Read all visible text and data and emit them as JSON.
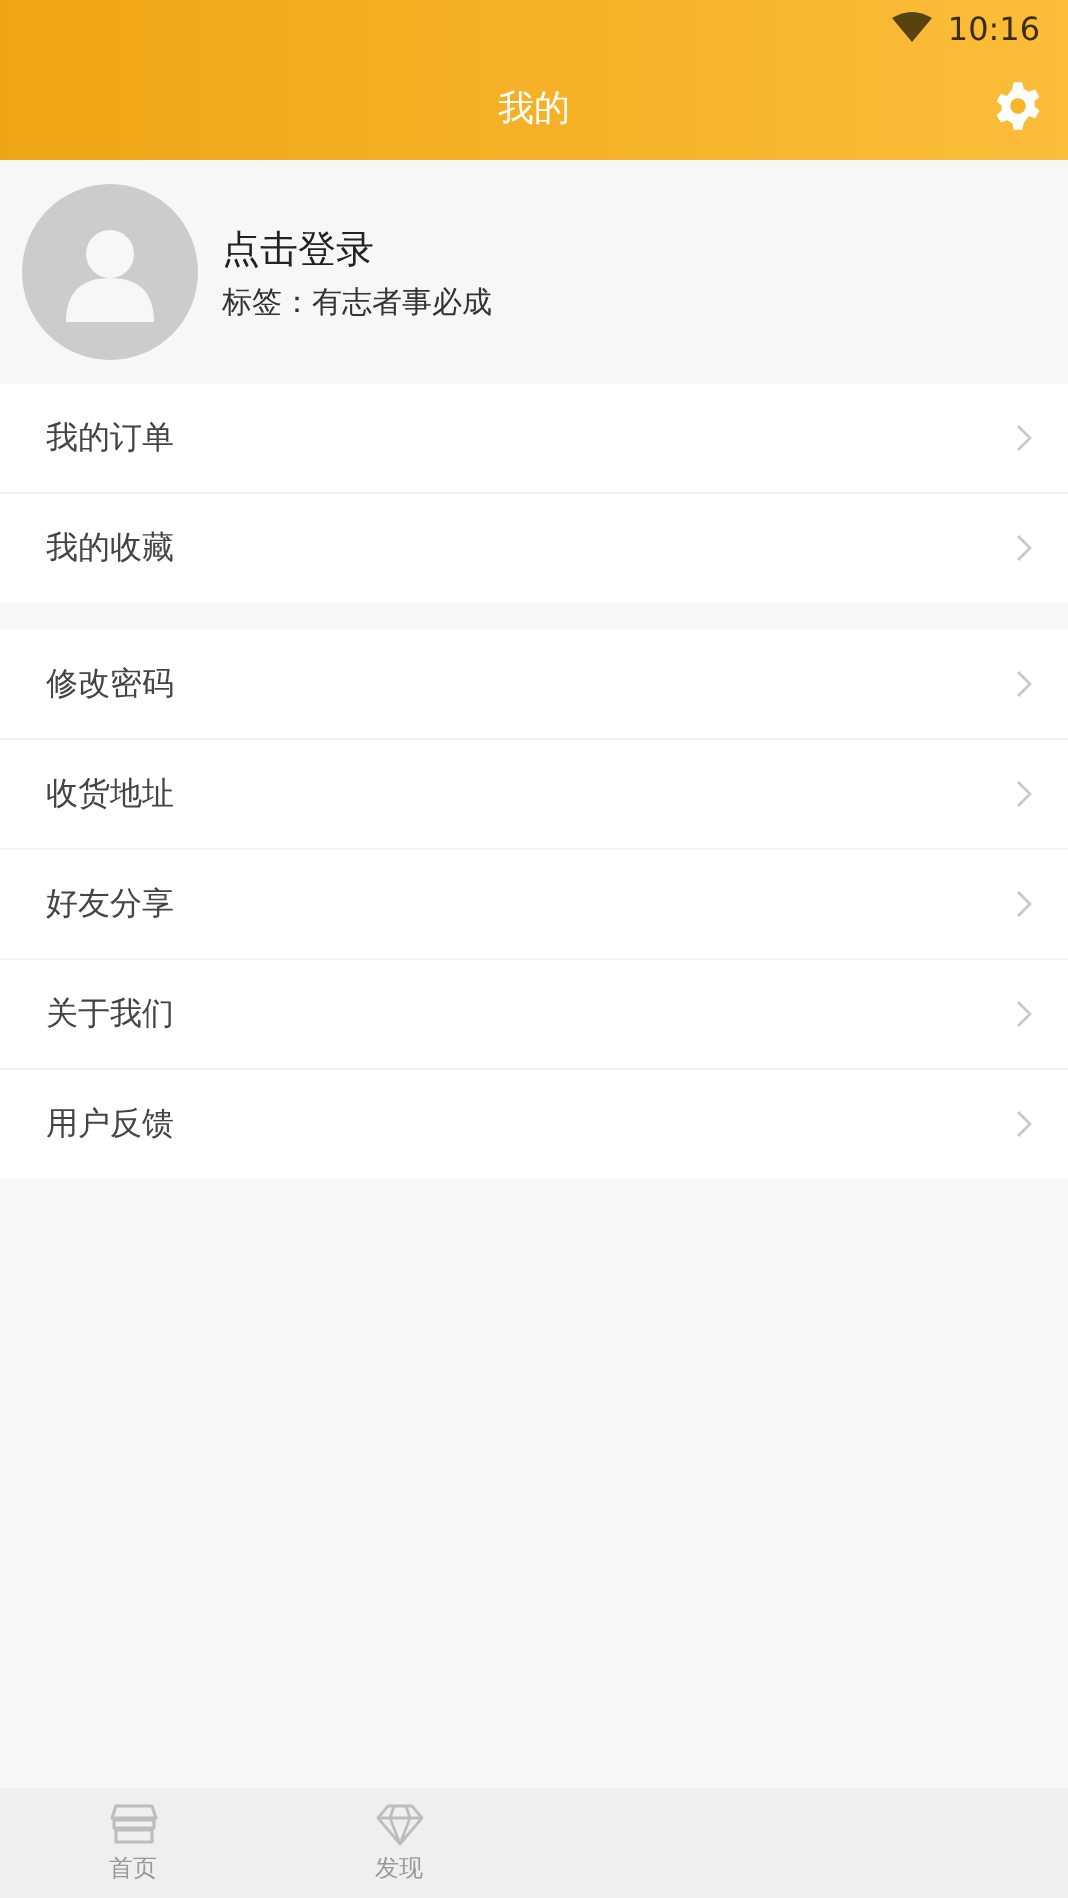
{
  "status_bar": {
    "time": "10:16"
  },
  "header": {
    "title": "我的"
  },
  "profile": {
    "name": "点击登录",
    "tag": "标签：有志者事必成"
  },
  "menu_groups": [
    {
      "items": [
        {
          "label": "我的订单"
        },
        {
          "label": "我的收藏"
        }
      ]
    },
    {
      "items": [
        {
          "label": "修改密码"
        },
        {
          "label": "收货地址"
        },
        {
          "label": "好友分享"
        },
        {
          "label": "关于我们"
        },
        {
          "label": "用户反馈"
        }
      ]
    }
  ],
  "tab_bar": [
    {
      "label": "首页"
    },
    {
      "label": "发现"
    }
  ]
}
